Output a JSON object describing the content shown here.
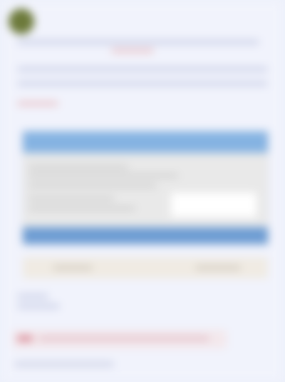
{
  "colors": {
    "background": "#eef1fb",
    "accent_blue": "#85b3e2",
    "accent_pink": "#d98a97"
  }
}
